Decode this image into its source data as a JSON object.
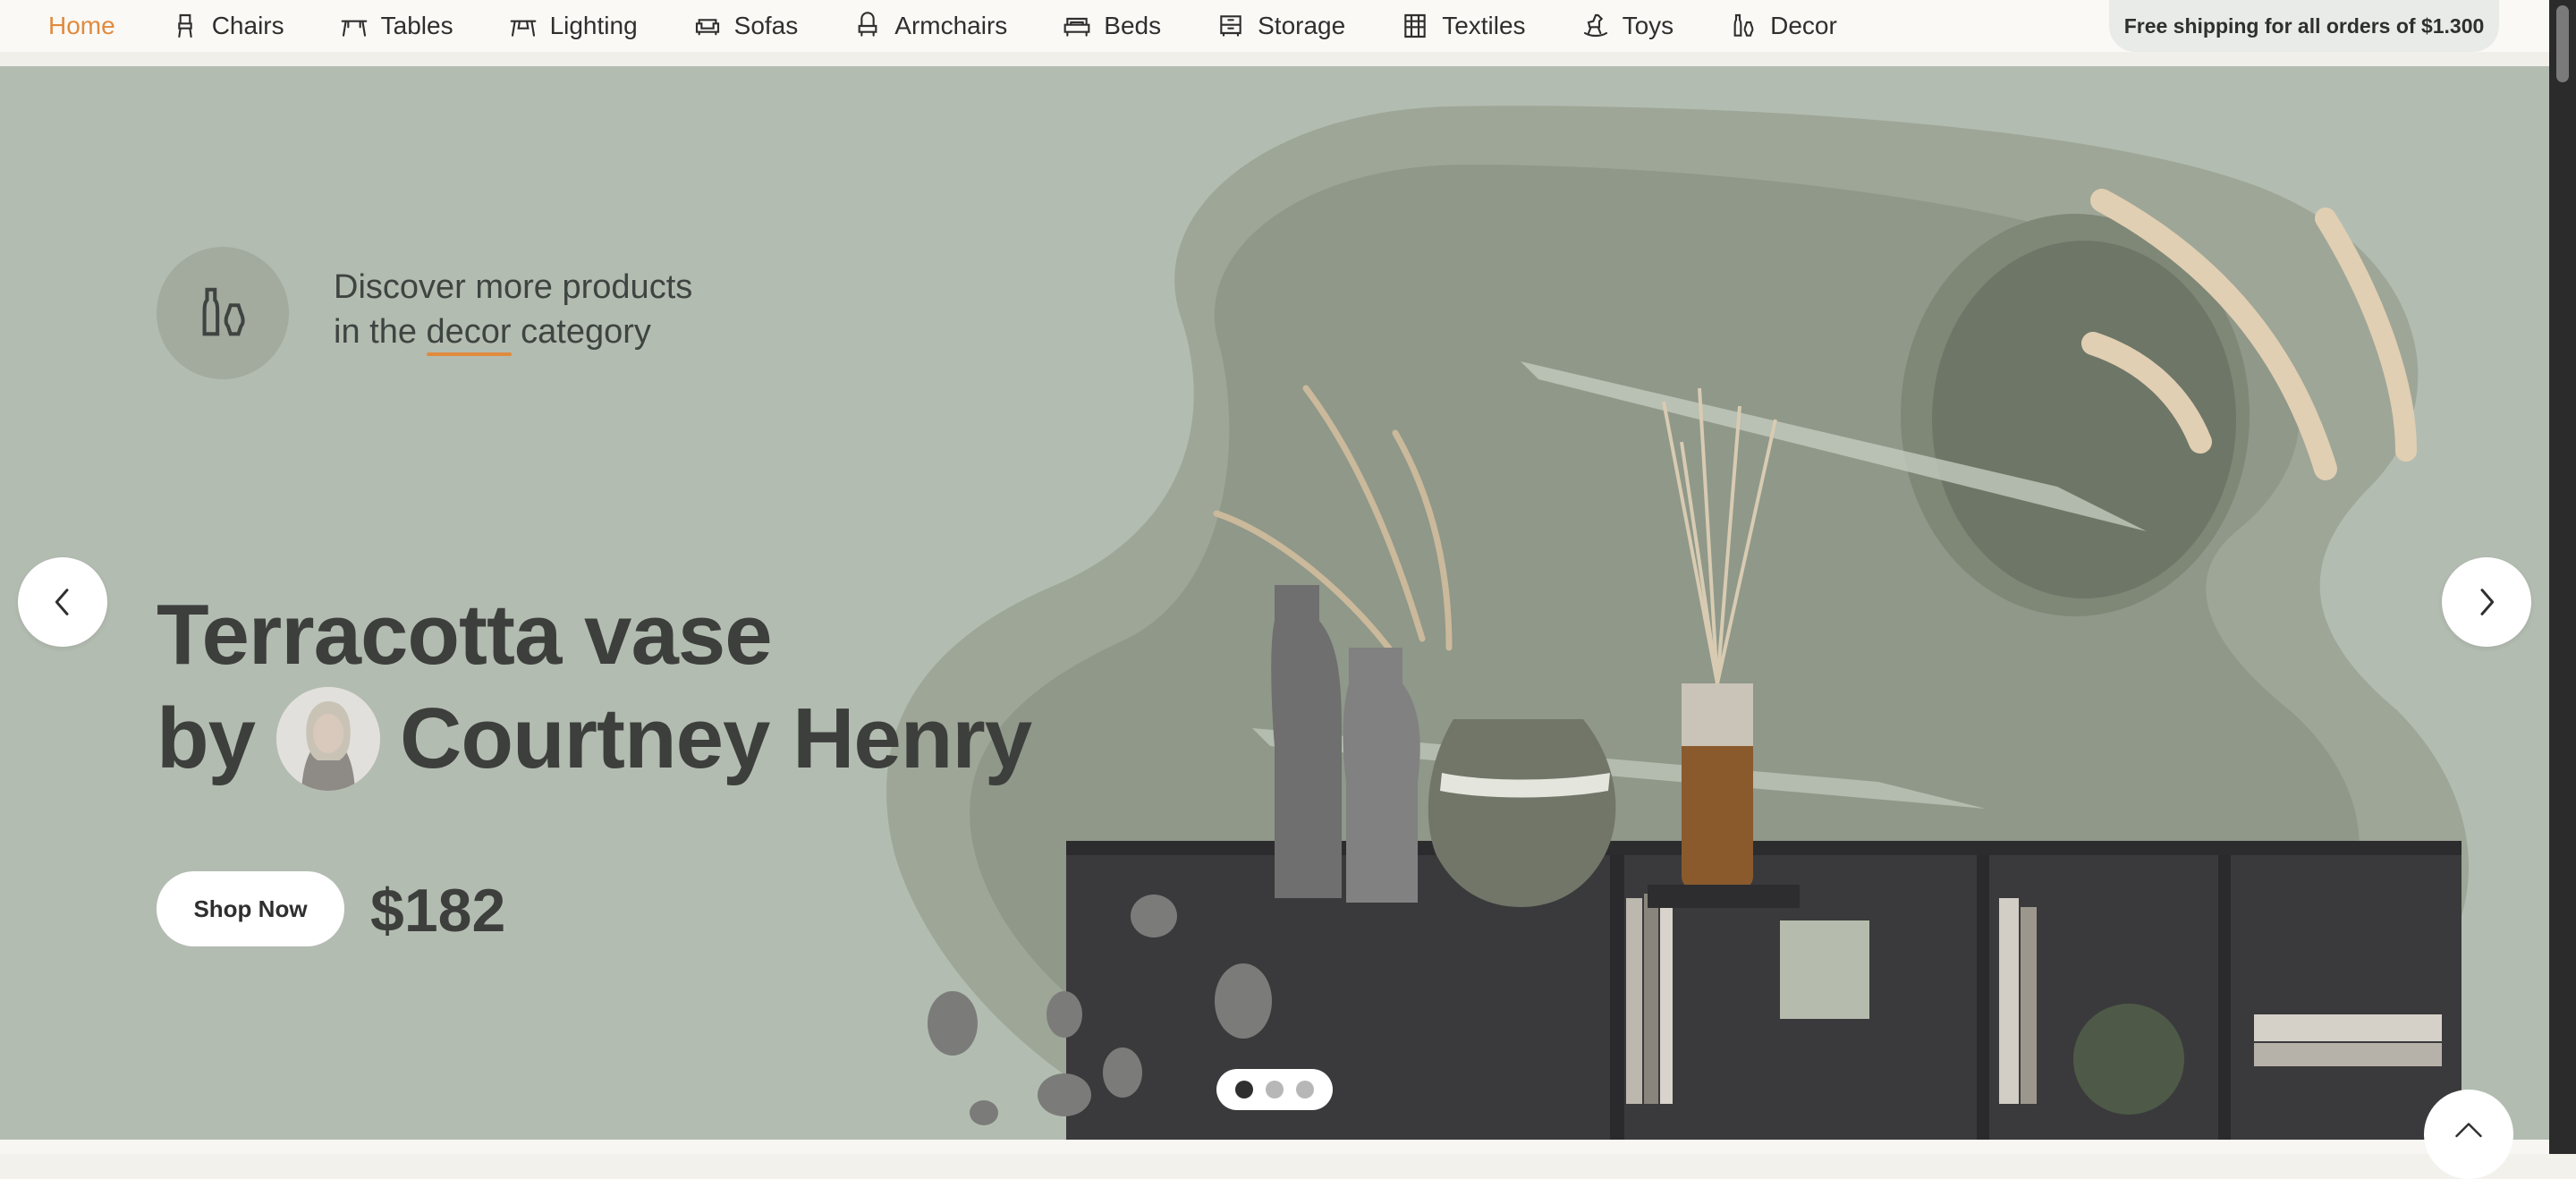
{
  "nav": {
    "items": [
      {
        "label": "Home",
        "icon": "none"
      },
      {
        "label": "Chairs",
        "icon": "chair-icon"
      },
      {
        "label": "Tables",
        "icon": "table-icon"
      },
      {
        "label": "Lighting",
        "icon": "lamp-icon"
      },
      {
        "label": "Sofas",
        "icon": "sofa-icon"
      },
      {
        "label": "Armchairs",
        "icon": "armchair-icon"
      },
      {
        "label": "Beds",
        "icon": "bed-icon"
      },
      {
        "label": "Storage",
        "icon": "storage-icon"
      },
      {
        "label": "Textiles",
        "icon": "textile-icon"
      },
      {
        "label": "Toys",
        "icon": "rocking-horse-icon"
      },
      {
        "label": "Decor",
        "icon": "vase-icon"
      }
    ],
    "promo": "Free shipping for all orders of $1.300"
  },
  "hero": {
    "category_line1": "Discover more products",
    "category_line2_pre": "in the",
    "category_keyword": "decor",
    "category_line2_post": "category",
    "title_line1": "Terracotta vase",
    "title_by": "by",
    "author": "Courtney Henry",
    "cta": "Shop Now",
    "price": "$182",
    "slides_total": 3,
    "active_slide": 1
  },
  "colors": {
    "accent": "#e08a3e",
    "hero_bg": "#b3bcb1",
    "text_dark": "#3d3f3c",
    "active_dot": "#2f2f2f"
  }
}
